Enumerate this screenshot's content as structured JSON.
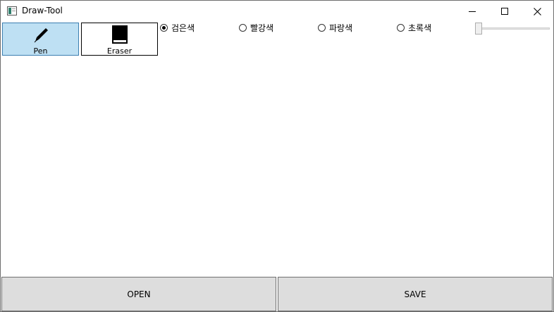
{
  "window": {
    "title": "Draw-Tool",
    "app_icon": "window-app-icon",
    "controls": {
      "minimize_icon": "minimize-icon",
      "maximize_icon": "maximize-icon",
      "close_icon": "close-icon"
    }
  },
  "toolbar": {
    "tools": [
      {
        "label": "Pen",
        "icon": "pen-icon",
        "selected": true
      },
      {
        "label": "Eraser",
        "icon": "eraser-icon",
        "selected": false
      }
    ],
    "colors": [
      {
        "label": "검은색",
        "checked": true
      },
      {
        "label": "빨강색",
        "checked": false
      },
      {
        "label": "파랑색",
        "checked": false
      },
      {
        "label": "초록색",
        "checked": false
      }
    ],
    "thickness_slider": {
      "value": 0
    }
  },
  "buttons": {
    "open_label": "OPEN",
    "save_label": "SAVE"
  },
  "colors": {
    "selected_tool_bg": "#bee0f3",
    "selected_tool_border": "#3c7fb1",
    "button_bg": "#dddddd"
  }
}
